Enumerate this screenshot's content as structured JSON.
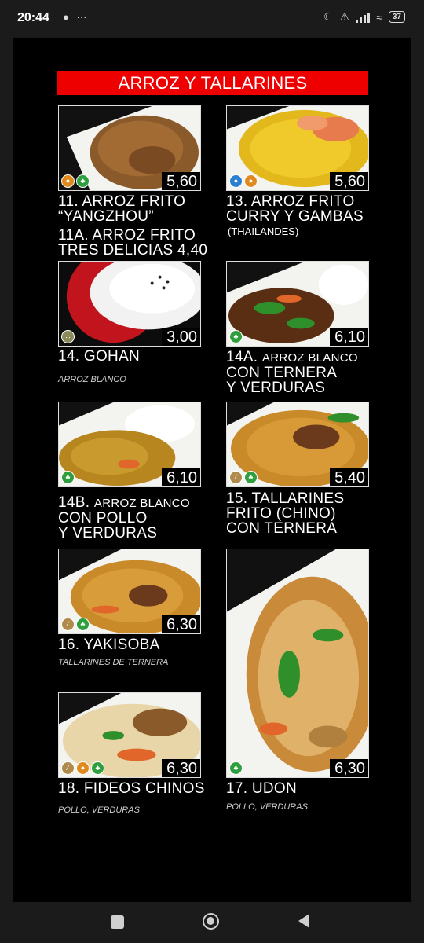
{
  "status_bar": {
    "time": "20:44",
    "left_icons": [
      "chat-bubble-icon",
      "more-dots-icon"
    ],
    "more": "···",
    "right_icons": [
      "moon-icon",
      "bell-off-icon",
      "signal-icon",
      "wifi-icon",
      "battery-icon"
    ],
    "battery": "37"
  },
  "menu": {
    "section_title": "ARROZ Y TALLARINES",
    "accent_color": "#ee0000",
    "items": [
      {
        "title_lines": [
          "11. ARROZ FRITO",
          "“YANGZHOU”"
        ],
        "price": "5,60",
        "extra_lines": [
          "11A. ARROZ FRITO",
          "TRES DELICIAS 4,40"
        ],
        "badges": [
          "egg-icon",
          "vegetable-icon"
        ]
      },
      {
        "title_lines": [
          "13. ARROZ FRITO",
          "CURRY Y GAMBAS"
        ],
        "price": "5,60",
        "subtitle": "(THAILANDES)",
        "badges": [
          "seafood-icon",
          "egg-icon"
        ]
      },
      {
        "title_lines": [
          "14. GOHAN"
        ],
        "price": "3,00",
        "subtitle": "ARROZ BLANCO",
        "badges": [
          "sesame-icon"
        ]
      },
      {
        "title_prefix": "14A.",
        "title_small": "ARROZ BLANCO",
        "title_lines": [
          "CON TERNERA",
          "Y VERDURAS"
        ],
        "price": "6,10",
        "badges": [
          "vegetable-icon"
        ]
      },
      {
        "title_prefix": "14B.",
        "title_small": "ARROZ BLANCO",
        "title_lines": [
          "CON POLLO",
          "Y VERDURAS"
        ],
        "price": "6,10",
        "badges": [
          "vegetable-icon"
        ]
      },
      {
        "title_lines": [
          "15. TALLARINES",
          "FRITO (CHINO)",
          "CON TERNERA"
        ],
        "price": "5,40",
        "badges": [
          "gluten-icon",
          "vegetable-icon"
        ]
      },
      {
        "title_lines": [
          "16. YAKISOBA"
        ],
        "price": "6,30",
        "subtitle": "TALLARINES DE TERNERA",
        "badges": [
          "gluten-icon",
          "vegetable-icon"
        ]
      },
      {
        "title_lines": [
          "17. UDON"
        ],
        "price": "6,30",
        "subtitle": "POLLO, VERDURAS",
        "badges": [
          "vegetable-icon"
        ]
      },
      {
        "title_lines": [
          "18. FIDEOS CHINOS"
        ],
        "price": "6,30",
        "subtitle": "POLLO, VERDURAS",
        "badges": [
          "gluten-icon",
          "egg-icon",
          "vegetable-icon"
        ]
      }
    ]
  },
  "nav_bar": {
    "buttons": [
      "recents-button",
      "home-button",
      "back-button"
    ]
  }
}
